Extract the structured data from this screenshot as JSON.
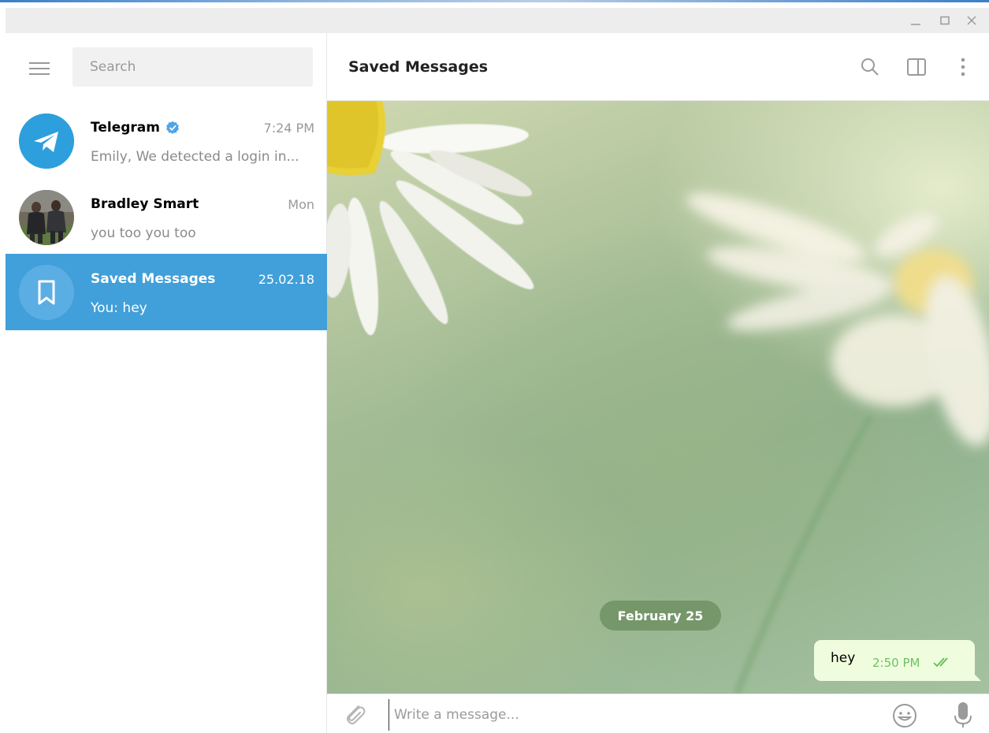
{
  "window": {
    "controls": [
      "minimize-icon",
      "maximize-icon",
      "close-icon"
    ],
    "accent_color": "#419fd9"
  },
  "sidebar": {
    "menu_icon": "hamburger-menu-icon",
    "search": {
      "placeholder": "Search",
      "value": ""
    },
    "chats": [
      {
        "name": "Telegram",
        "verified": true,
        "time": "7:24 PM",
        "preview": "Emily,  We detected a login in...",
        "avatar": "telegram-logo"
      },
      {
        "name": "Bradley Smart",
        "verified": false,
        "time": "Mon",
        "preview": "you too you too",
        "avatar": "photo"
      },
      {
        "name": "Saved Messages",
        "verified": false,
        "time": "25.02.18",
        "preview": "You: hey",
        "avatar": "bookmark-icon",
        "active": true
      }
    ]
  },
  "chat": {
    "title": "Saved Messages",
    "header_icons": [
      "search-icon",
      "sidebar-toggle-icon",
      "more-vertical-icon"
    ],
    "date_separator": "February 25",
    "messages": [
      {
        "text": "hey",
        "time": "2:50 PM",
        "status": "read",
        "outgoing": true
      }
    ],
    "composer": {
      "placeholder": "Write a message...",
      "icons": [
        "attach-icon",
        "emoji-icon",
        "microphone-icon"
      ]
    }
  }
}
